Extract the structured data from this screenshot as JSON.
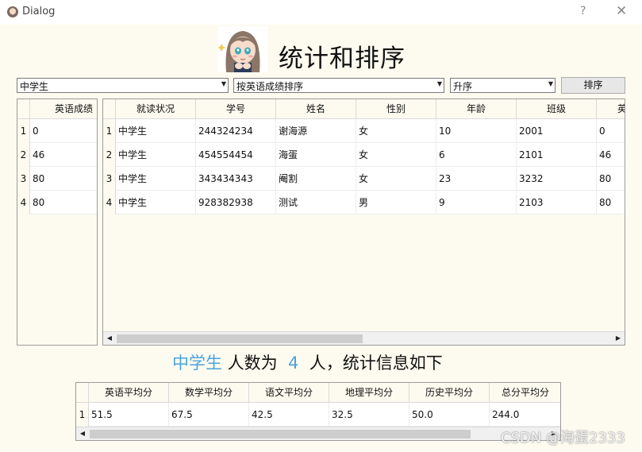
{
  "window": {
    "title": "Dialog",
    "help_glyph": "?",
    "close_glyph": "✕"
  },
  "header": {
    "title": "统计和排序"
  },
  "controls": {
    "status_filter": "中学生",
    "sort_field": "按英语成绩排序",
    "sort_order": "升序",
    "sort_button": "排序"
  },
  "left_table": {
    "header": "英语成绩",
    "rows": [
      {
        "num": "1",
        "value": "0"
      },
      {
        "num": "2",
        "value": "46"
      },
      {
        "num": "3",
        "value": "80"
      },
      {
        "num": "4",
        "value": "80"
      }
    ]
  },
  "main_table": {
    "columns": [
      "就读状况",
      "学号",
      "姓名",
      "性别",
      "年龄",
      "班级",
      "英"
    ],
    "rows": [
      {
        "num": "1",
        "cells": [
          "中学生",
          "244324234",
          "谢海源",
          "女",
          "10",
          "2001",
          "0"
        ]
      },
      {
        "num": "2",
        "cells": [
          "中学生",
          "454554454",
          "海蛋",
          "女",
          "6",
          "2101",
          "46"
        ]
      },
      {
        "num": "3",
        "cells": [
          "中学生",
          "343434343",
          "阉割",
          "女",
          "23",
          "3232",
          "80"
        ]
      },
      {
        "num": "4",
        "cells": [
          "中学生",
          "928382938",
          "测试",
          "男",
          "9",
          "2103",
          "80"
        ]
      }
    ]
  },
  "summary": {
    "group": "中学生",
    "text1": "人数为",
    "count": "4",
    "text2": "人，统计信息如下"
  },
  "stats_table": {
    "columns": [
      "英语平均分",
      "数学平均分",
      "语文平均分",
      "地理平均分",
      "历史平均分",
      "总分平均分"
    ],
    "row_num": "1",
    "values": [
      "51.5",
      "67.5",
      "42.5",
      "32.5",
      "50.0",
      "244.0"
    ]
  },
  "watermark": "CSDN @海蛋2333",
  "colors": {
    "background": "#fdfbef",
    "highlight": "#4aa3df"
  }
}
